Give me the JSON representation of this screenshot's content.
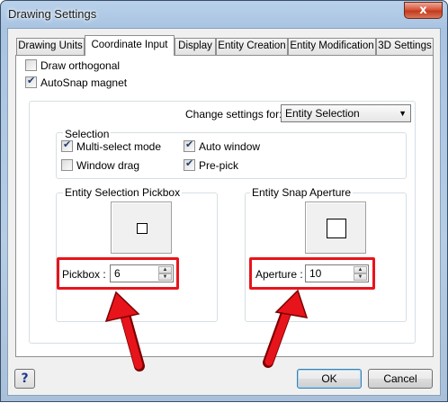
{
  "window": {
    "title": "Drawing Settings",
    "close_glyph": "x"
  },
  "tabs": [
    {
      "label": "Drawing Units"
    },
    {
      "label": "Coordinate Input"
    },
    {
      "label": "Display"
    },
    {
      "label": "Entity Creation"
    },
    {
      "label": "Entity Modification"
    },
    {
      "label": "3D Settings"
    }
  ],
  "active_tab": "Coordinate Input",
  "options": {
    "draw_orthogonal": {
      "label": "Draw orthogonal",
      "checked": false
    },
    "autosnap_magnet": {
      "label": "AutoSnap magnet",
      "checked": true
    }
  },
  "change_settings": {
    "label": "Change settings for:",
    "selected": "Entity Selection",
    "arrow": "▼"
  },
  "selection_group": {
    "title": "Selection",
    "multi_select": {
      "label": "Multi-select mode",
      "checked": true
    },
    "auto_window": {
      "label": "Auto window",
      "checked": true
    },
    "window_drag": {
      "label": "Window drag",
      "checked": false
    },
    "pre_pick": {
      "label": "Pre-pick",
      "checked": true
    }
  },
  "pickbox_group": {
    "title": "Entity Selection Pickbox",
    "field_label": "Pickbox :",
    "value": "6"
  },
  "aperture_group": {
    "title": "Entity Snap Aperture",
    "field_label": "Aperture :",
    "value": "10"
  },
  "spin": {
    "up": "▲",
    "down": "▼"
  },
  "footer": {
    "help_label": "?",
    "ok_label": "OK",
    "cancel_label": "Cancel"
  },
  "colors": {
    "highlight": "#e8141b",
    "accent": "#3c7fb1"
  }
}
